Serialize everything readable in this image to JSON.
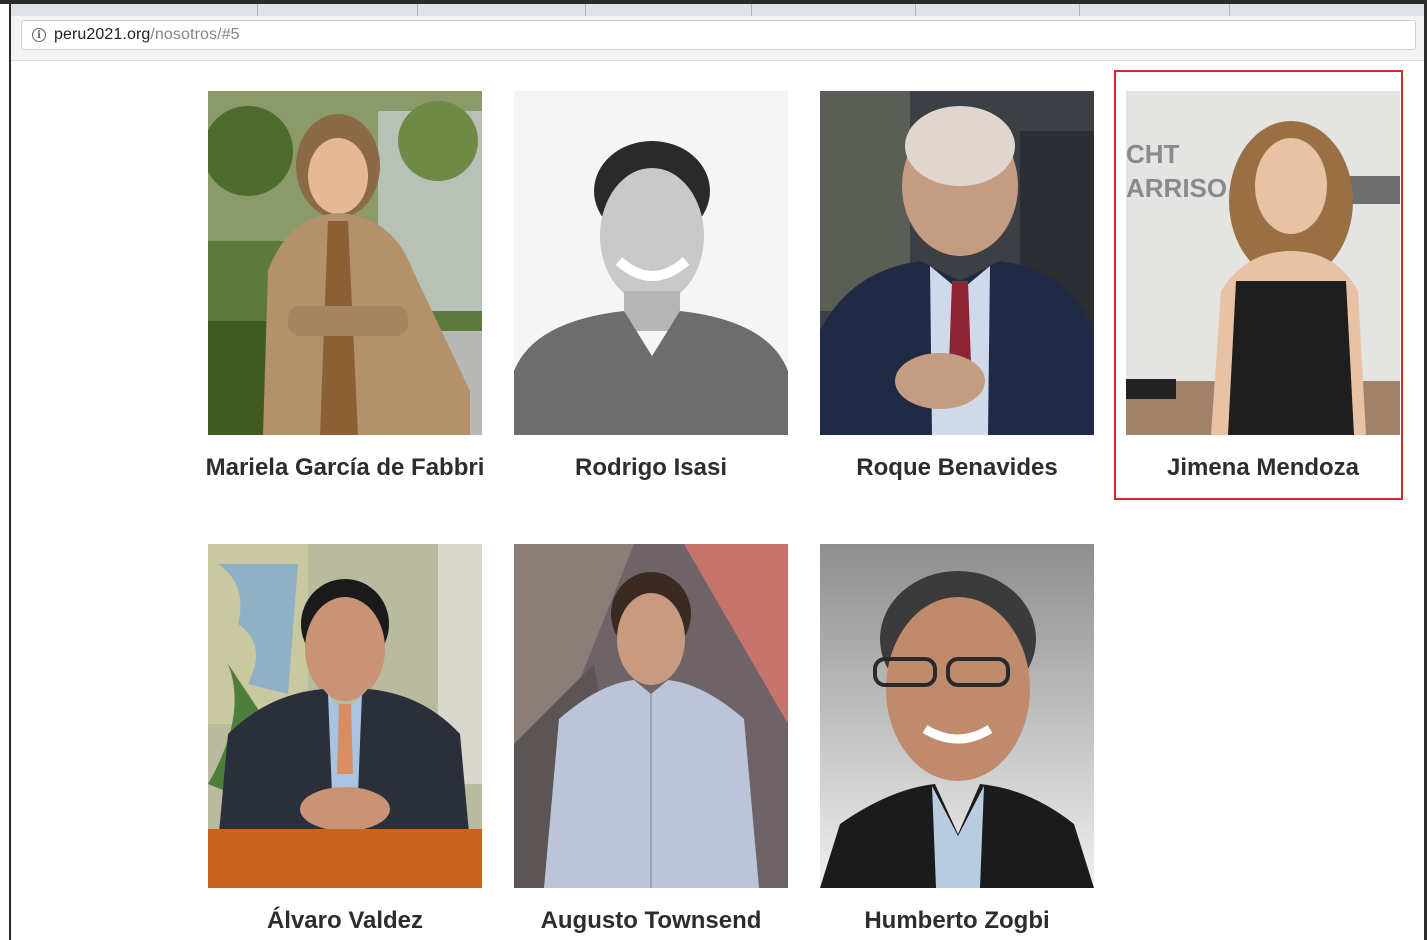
{
  "browser": {
    "url_host": "peru2021.org",
    "url_path": "/nosotros/#5",
    "info_icon": "info-circle-icon"
  },
  "team": {
    "members": [
      {
        "name": "Mariela García de Fabbri"
      },
      {
        "name": "Rodrigo Isasi"
      },
      {
        "name": "Roque Benavides"
      },
      {
        "name": "Jimena Mendoza",
        "highlighted": true
      },
      {
        "name": "Álvaro Valdez"
      },
      {
        "name": "Augusto Townsend"
      },
      {
        "name": "Humberto Zogbi"
      }
    ]
  },
  "colors": {
    "highlight_border": "#d9262a",
    "name_text": "#2d2d2d"
  },
  "backdrop_text": {
    "line1": "CHT",
    "line2": "ARRISO"
  }
}
